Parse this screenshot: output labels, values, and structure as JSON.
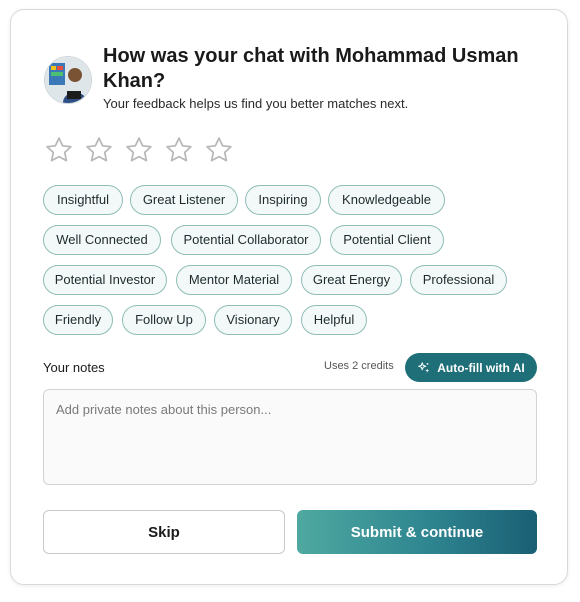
{
  "header": {
    "title": "How was your chat with Mohammad Usman Khan?",
    "subtitle": "Your feedback helps us find you better matches next."
  },
  "rating": {
    "value": 0,
    "max": 5
  },
  "tags": [
    "Insightful",
    "Great Listener",
    "Inspiring",
    "Knowledgeable",
    "Well Connected",
    "Potential Collaborator",
    "Potential Client",
    "Potential Investor",
    "Mentor Material",
    "Great Energy",
    "Professional",
    "Friendly",
    "Follow Up",
    "Visionary",
    "Helpful"
  ],
  "notes": {
    "label": "Your notes",
    "credits": "Uses 2 credits",
    "autofill_label": "Auto-fill with AI",
    "placeholder": "Add private notes about this person...",
    "value": ""
  },
  "actions": {
    "skip_label": "Skip",
    "submit_label": "Submit & continue"
  },
  "colors": {
    "accent": "#1e6f78",
    "tag_border": "#8fbdb8",
    "tag_bg": "#f2f9f8"
  }
}
